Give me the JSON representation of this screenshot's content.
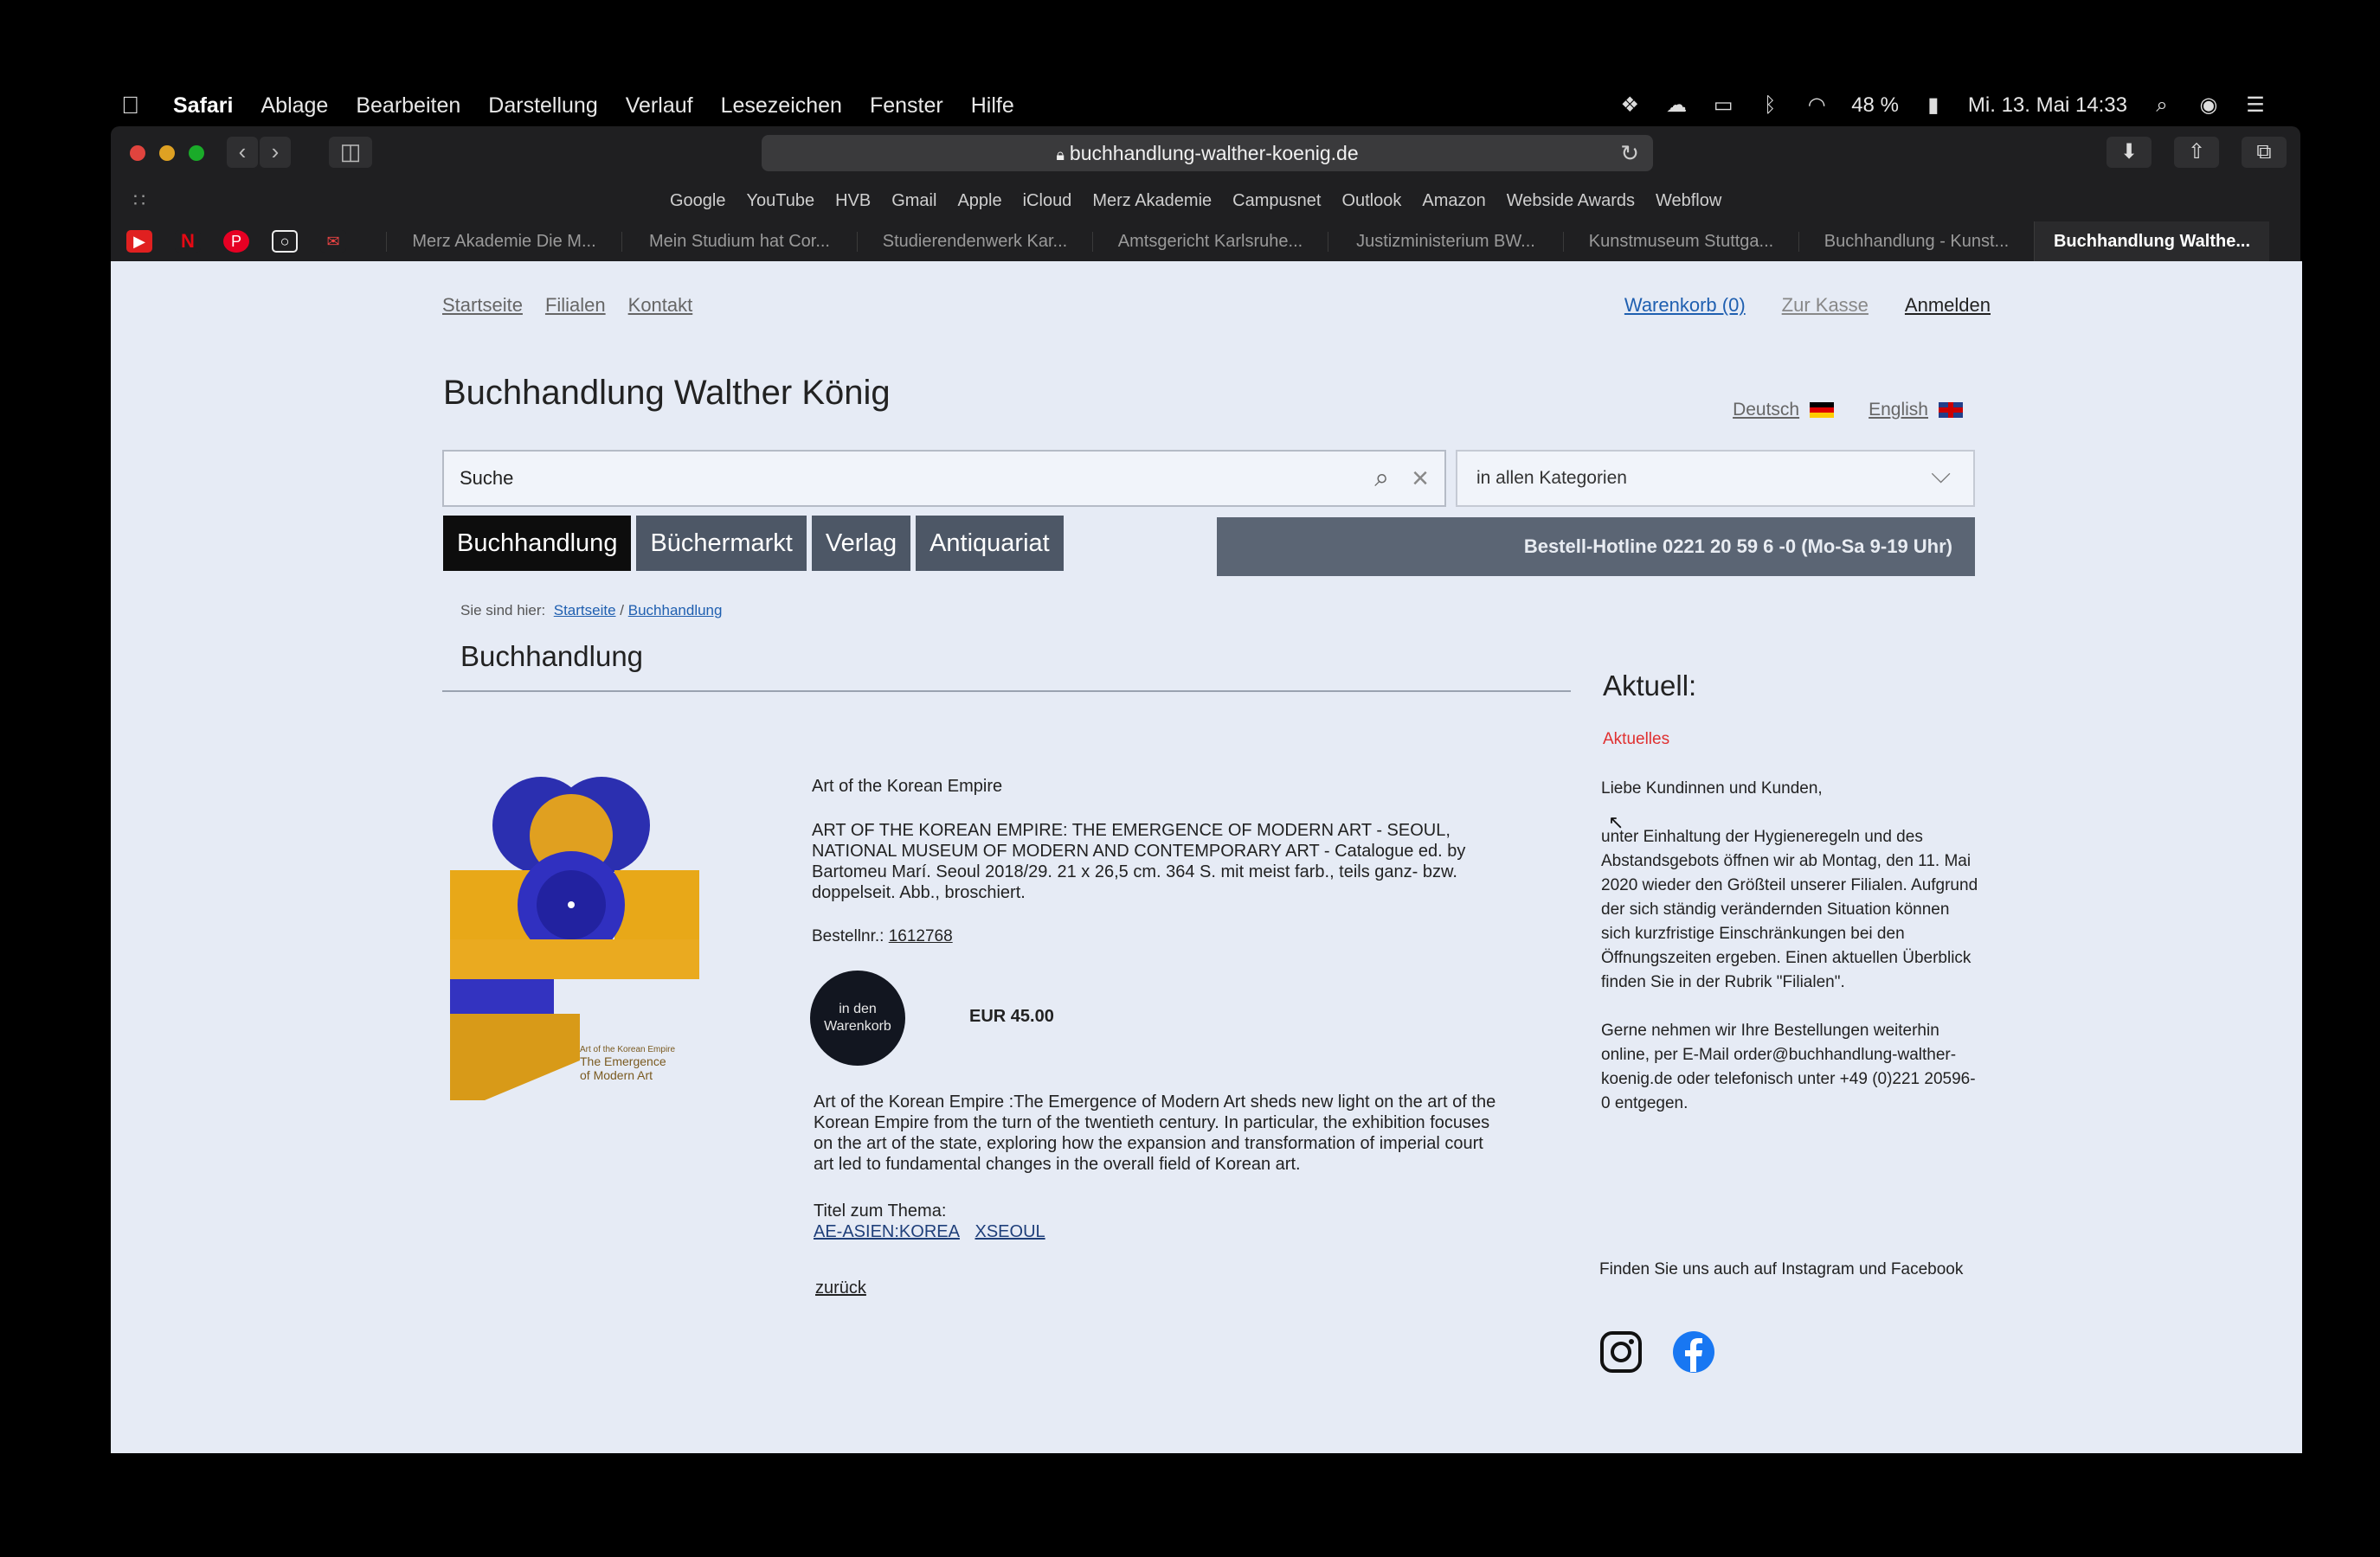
{
  "menubar": {
    "app": "Safari",
    "items": [
      "Ablage",
      "Bearbeiten",
      "Darstellung",
      "Verlauf",
      "Lesezeichen",
      "Fenster",
      "Hilfe"
    ],
    "battery": "48 %",
    "datetime": "Mi. 13. Mai 14:33"
  },
  "browser": {
    "url": "buchhandlung-walther-koenig.de",
    "favorites": [
      "Google",
      "YouTube",
      "HVB",
      "Gmail",
      "Apple",
      "iCloud",
      "Merz Akademie",
      "Campusnet",
      "Outlook",
      "Amazon",
      "Webside Awards",
      "Webflow"
    ],
    "tabs": [
      "Merz Akademie Die M...",
      "Mein Studium hat Cor...",
      "Studierendenwerk Kar...",
      "Amtsgericht Karlsruhe...",
      "Justizministerium BW...",
      "Kunstmuseum Stuttga...",
      "Buchhandlung - Kunst...",
      "Buchhandlung Walthe..."
    ]
  },
  "site": {
    "topnav": [
      "Startseite",
      "Filialen",
      "Kontakt"
    ],
    "cart": "Warenkorb (0)",
    "checkout": "Zur Kasse",
    "login": "Anmelden",
    "title": "Buchhandlung Walther König",
    "lang_de": "Deutsch",
    "lang_en": "English",
    "search_value": "Suche",
    "category": "in allen Kategorien",
    "navtabs": [
      "Buchhandlung",
      "Büchermarkt",
      "Verlag",
      "Antiquariat"
    ],
    "hotline": "Bestell-Hotline 0221 20 59 6 -0 (Mo-Sa 9-19 Uhr)",
    "breadcrumb_prefix": "Sie sind hier:",
    "breadcrumb_home": "Startseite",
    "breadcrumb_sep": "/",
    "breadcrumb_current": "Buchhandlung",
    "section_title": "Buchhandlung"
  },
  "product": {
    "name": "Art of the Korean Empire",
    "description": "ART OF THE KOREAN EMPIRE: THE EMERGENCE OF MODERN ART - SEOUL, NATIONAL MUSEUM OF MODERN AND CONTEMPORARY ART - Catalogue ed. by Bartomeu Marí. Seoul 2018/29. 21 x 26,5 cm. 364 S. mit meist farb., teils ganz- bzw. doppelseit. Abb., broschiert.",
    "order_label": "Bestellnr.:",
    "order_number": "1612768",
    "cart_button_line1": "in den",
    "cart_button_line2": "Warenkorb",
    "price": "EUR 45.00",
    "long_description": "Art of the Korean Empire :The Emergence of Modern Art sheds new light on the art of the Korean Empire from the turn of the twentieth century. In particular, the exhibition focuses on the art of the state, exploring how the expansion and transformation of imperial court art led to fundamental changes in the overall field of Korean art.",
    "related_label": "Titel zum Thema:",
    "related_links": [
      "AE-ASIEN:KOREA",
      "XSEOUL"
    ],
    "back": "zurück",
    "cover_text": [
      "Art of the Korean Empire",
      "The Emergence",
      "of Modern Art"
    ]
  },
  "aside": {
    "heading": "Aktuell:",
    "red_link": "Aktuelles",
    "greeting": "Liebe Kundinnen und Kunden,",
    "para1": "unter Einhaltung der Hygieneregeln und des Abstandsgebots öffnen wir ab Montag, den 11. Mai 2020 wieder den Größteil unserer Filialen. Aufgrund der sich ständig verändernden Situation können sich kurzfristige Einschränkungen bei den Öffnungszeiten ergeben. Einen aktuellen Überblick finden Sie in der Rubrik \"Filialen\".",
    "para2": "Gerne nehmen wir Ihre Bestellungen weiterhin online, per E-Mail order@buchhandlung-walther-koenig.de oder telefonisch unter +49 (0)221 20596-0 entgegen.",
    "social": "Finden Sie uns auch auf Instagram und Facebook"
  },
  "colors": {
    "accent_link": "#1f5fb0",
    "nav_active": "#0d0d0d",
    "nav_tab": "#4d5766",
    "news_red": "#e03030"
  }
}
